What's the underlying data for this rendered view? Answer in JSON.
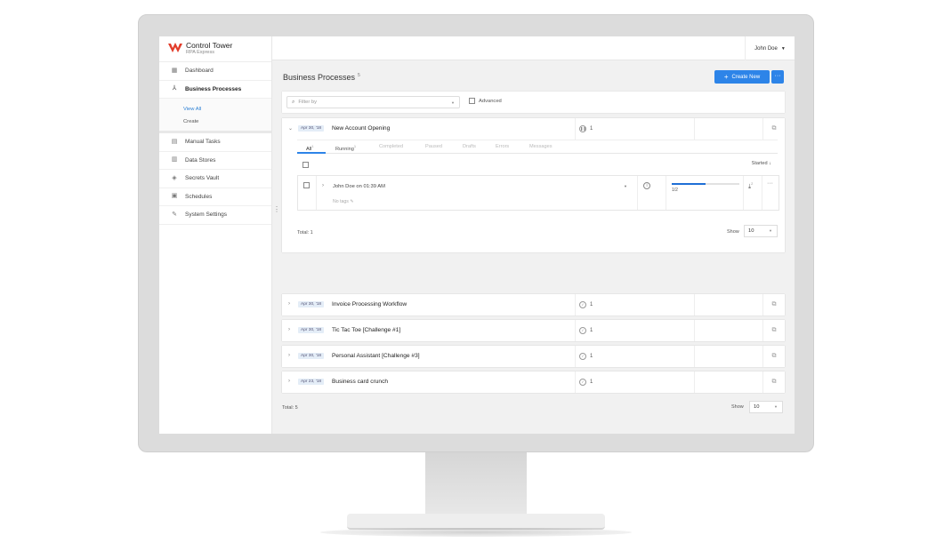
{
  "brand": {
    "title": "Control Tower",
    "subtitle": "RPA Express"
  },
  "topbar": {
    "user": "John Doe"
  },
  "sidebar": {
    "items": [
      {
        "label": "Dashboard",
        "icon": "dashboard-icon"
      },
      {
        "label": "Business Processes",
        "icon": "process-icon"
      },
      {
        "label": "Manual Tasks",
        "icon": "task-icon"
      },
      {
        "label": "Data Stores",
        "icon": "data-store-icon"
      },
      {
        "label": "Secrets Vault",
        "icon": "shield-icon"
      },
      {
        "label": "Schedules",
        "icon": "calendar-icon"
      },
      {
        "label": "System Settings",
        "icon": "wrench-icon"
      }
    ],
    "sub_items": [
      "View All",
      "Create"
    ]
  },
  "main": {
    "title": "Business Processes",
    "count": "5",
    "create_label": "Create New",
    "more_label": "···",
    "filter_placeholder": "Filter by",
    "advanced_label": "Advanced",
    "total": "Total: 5",
    "show_label": "Show",
    "show_value": "10"
  },
  "processes": [
    {
      "date": "Apr 30, '18",
      "name": "New Account Opening",
      "count": "1"
    },
    {
      "date": "Apr 30, '18",
      "name": "Invoice Processing Workflow",
      "count": "1"
    },
    {
      "date": "Apr 30, '18",
      "name": "Tic Tac Toe [Challenge #1]",
      "count": "1"
    },
    {
      "date": "Apr 30, '18",
      "name": "Personal Assistant [Challenge #3]",
      "count": "1"
    },
    {
      "date": "Apr 23, '18",
      "name": "Business card crunch",
      "count": "1"
    }
  ],
  "expanded": {
    "tabs": [
      {
        "label": "All",
        "count": "1"
      },
      {
        "label": "Running",
        "count": "1"
      },
      {
        "label": "Completed"
      },
      {
        "label": "Paused"
      },
      {
        "label": "Drafts"
      },
      {
        "label": "Errors"
      },
      {
        "label": "Messages"
      }
    ],
    "sort_label": "Started",
    "instance": {
      "name": "John Doe on 01:39 AM",
      "tags": "No tags",
      "progress_text": "1/2",
      "progress": 0.5,
      "badge": "2"
    },
    "total": "Total: 1",
    "show_label": "Show",
    "show_value": "10"
  },
  "colors": {
    "accent": "#2d84e8",
    "logo": "#e23c2a"
  }
}
